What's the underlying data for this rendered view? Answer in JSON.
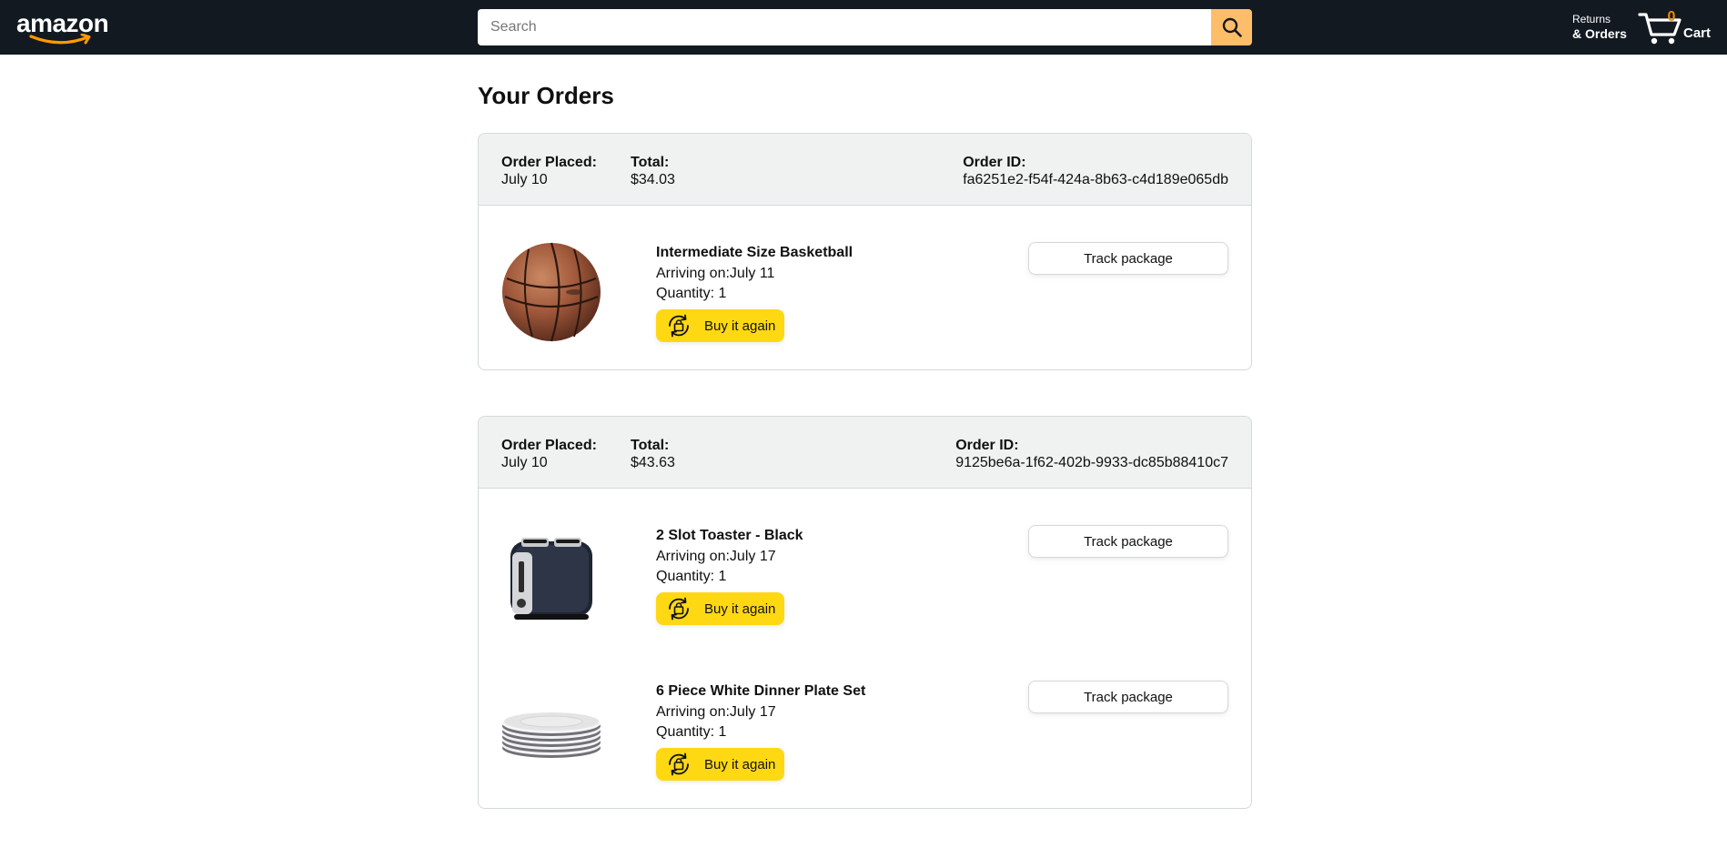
{
  "header": {
    "logo_text": "amazon",
    "search_placeholder": "Search",
    "returns_top": "Returns",
    "returns_bottom": "& Orders",
    "cart_count": "0",
    "cart_label": "Cart",
    "colors": {
      "bar": "#131921",
      "search_button": "#febd69",
      "cart_count": "#f08804"
    }
  },
  "page": {
    "title": "Your Orders"
  },
  "labels": {
    "order_placed": "Order Placed:",
    "total": "Total:",
    "order_id": "Order ID:",
    "track": "Track package",
    "buy_again": "Buy it again",
    "arriving_prefix": "Arriving on:",
    "quantity_prefix": "Quantity: "
  },
  "orders": [
    {
      "placed": "July 10",
      "total": "$34.03",
      "id": "fa6251e2-f54f-424a-8b63-c4d189e065db",
      "items": [
        {
          "name": "Intermediate Size Basketball",
          "arriving": "Arriving on:July 11",
          "quantity": "Quantity: 1",
          "image": "basketball"
        }
      ]
    },
    {
      "placed": "July 10",
      "total": "$43.63",
      "id": "9125be6a-1f62-402b-9933-dc85b88410c7",
      "items": [
        {
          "name": "2 Slot Toaster - Black",
          "arriving": "Arriving on:July 17",
          "quantity": "Quantity: 1",
          "image": "toaster"
        },
        {
          "name": "6 Piece White Dinner Plate Set",
          "arriving": "Arriving on:July 17",
          "quantity": "Quantity: 1",
          "image": "plates"
        }
      ]
    }
  ],
  "icons": {
    "search": "search-icon",
    "cart": "cart-icon",
    "buy_again": "buy-again-icon"
  },
  "accent": {
    "buy_button": "#ffd814"
  }
}
